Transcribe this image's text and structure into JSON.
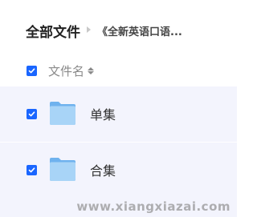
{
  "breadcrumb": {
    "root": "全部文件",
    "current": "《全新英语口语..."
  },
  "table_header": {
    "column_name": "文件名"
  },
  "files": [
    {
      "name": "单集",
      "type": "folder",
      "checked": true
    },
    {
      "name": "合集",
      "type": "folder",
      "checked": true
    }
  ],
  "watermark": "www.xiangxiazai.com",
  "colors": {
    "accent": "#1a66ff",
    "row_highlight": "#f3f4fd",
    "folder_light": "#a8d4f7",
    "folder_dark": "#6fb2ee"
  },
  "icons": {
    "folder": "folder-icon",
    "sort": "sort-icon",
    "separator": "chevron-right-icon",
    "checkbox": "checkbox-checked-icon"
  }
}
